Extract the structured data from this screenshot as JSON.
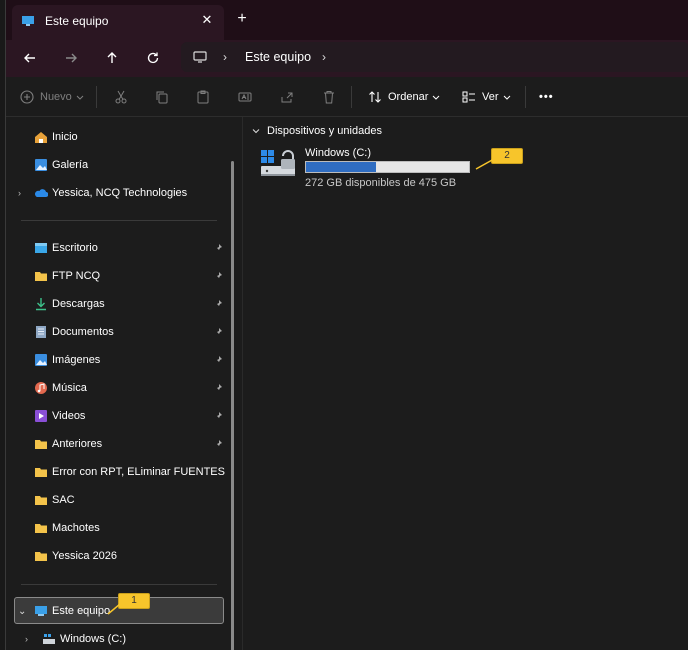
{
  "tab": {
    "title": "Este equipo",
    "close": "✕",
    "new": "+"
  },
  "nav": {
    "back": "←",
    "forward": "→",
    "up": "↑",
    "refresh": "⟳"
  },
  "address": {
    "segment": "Este equipo",
    "sep": "›"
  },
  "toolbar": {
    "new_label": "Nuevo",
    "sort_label": "Ordenar",
    "view_label": "Ver",
    "more": "•••"
  },
  "sidebar": {
    "top": [
      {
        "label": "Inicio",
        "icon": "home-icon"
      },
      {
        "label": "Galería",
        "icon": "gallery-icon"
      },
      {
        "label": "Yessica, NCQ Technologies",
        "icon": "onedrive-icon"
      }
    ],
    "quick": [
      {
        "label": "Escritorio",
        "icon": "desktop-icon",
        "pinned": true
      },
      {
        "label": "FTP NCQ",
        "icon": "folder-icon",
        "pinned": true
      },
      {
        "label": "Descargas",
        "icon": "download-icon",
        "pinned": true
      },
      {
        "label": "Documentos",
        "icon": "documents-icon",
        "pinned": true
      },
      {
        "label": "Imágenes",
        "icon": "pictures-icon",
        "pinned": true
      },
      {
        "label": "Música",
        "icon": "music-icon",
        "pinned": true
      },
      {
        "label": "Videos",
        "icon": "videos-icon",
        "pinned": true
      },
      {
        "label": "Anteriores",
        "icon": "folder-icon",
        "pinned": true
      },
      {
        "label": "Error con RPT, ELiminar FUENTES",
        "icon": "folder-icon",
        "pinned": false
      },
      {
        "label": "SAC",
        "icon": "folder-icon",
        "pinned": false
      },
      {
        "label": "Machotes",
        "icon": "folder-icon",
        "pinned": false
      },
      {
        "label": "Yessica 2026",
        "icon": "folder-icon",
        "pinned": false
      }
    ],
    "this_pc": "Este equipo",
    "windows_drive": "Windows  (C:)"
  },
  "main": {
    "group": "Dispositivos y unidades",
    "drive": {
      "name": "Windows  (C:)",
      "free_text": "272 GB disponibles de 475 GB",
      "used_fraction": 0.427
    }
  },
  "callouts": {
    "one": "1",
    "two": "2"
  },
  "colors": {
    "accent": "#2f6dc2",
    "callout": "#f7c52b",
    "folder": "#f3c34a"
  }
}
